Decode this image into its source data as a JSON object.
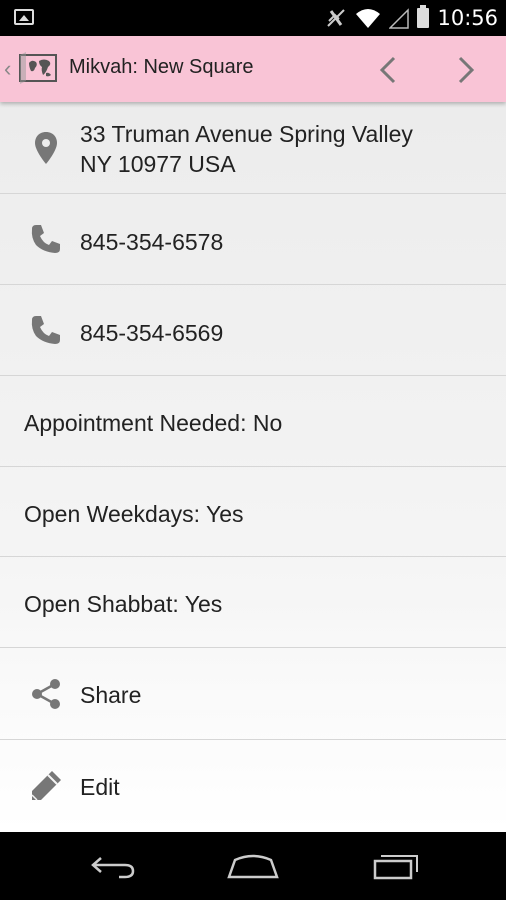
{
  "status_bar": {
    "time": "10:56"
  },
  "action_bar": {
    "title": "Mikvah: New Square"
  },
  "details": {
    "address_line1": "33 Truman Avenue Spring Valley",
    "address_line2": "NY 10977 USA",
    "phone1": "845-354-6578",
    "phone2": "845-354-6569",
    "appointment": "Appointment Needed: No",
    "weekdays": "Open Weekdays: Yes",
    "shabbat": "Open Shabbat: Yes",
    "share_label": "Share",
    "edit_label": "Edit"
  },
  "colors": {
    "action_bar_bg": "#f9c4d6",
    "icon_gray": "#777777"
  }
}
